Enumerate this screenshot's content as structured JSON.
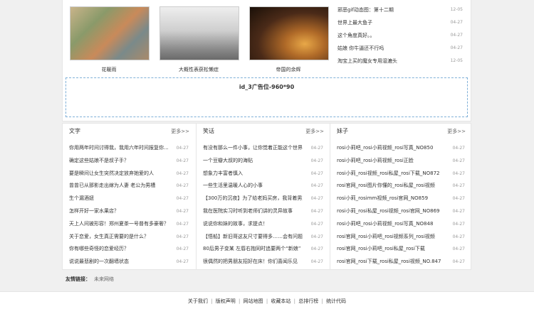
{
  "gallery": [
    {
      "caption": "花暖雨",
      "image": "rooftop-village-photo"
    },
    {
      "caption": "大概性表获松懒症",
      "image": "person-sitting-photo"
    },
    {
      "caption": "帝国的余辉",
      "image": "sunset-silhouette-photo"
    }
  ],
  "news": [
    {
      "title": "邪恶gif动态图：第十二期",
      "date": "12-05"
    },
    {
      "title": "世界上最大鱼子",
      "date": "04-27"
    },
    {
      "title": "这个角度真好。。",
      "date": "04-27"
    },
    {
      "title": "姑娘 你牛逼还不行吗",
      "date": "04-27"
    },
    {
      "title": "淘宝上买的魔女专用湿漉头",
      "date": "12-05"
    }
  ],
  "ad": {
    "label": "id_3广告位-960*90"
  },
  "columns": [
    {
      "title": "文字",
      "more": "更多>>",
      "items": [
        {
          "title": "你用两年时间讨得我，我用六年时间报复你...",
          "date": "04-27"
        },
        {
          "title": "确定这些姑娘不是叔子手？",
          "date": "04-27"
        },
        {
          "title": "要是瞬间让女生突然决定放弃她爱的人",
          "date": "04-27"
        },
        {
          "title": "曾曾已从那影走出嫁为人妻 老公为男槽",
          "date": "04-27"
        },
        {
          "title": "生个漏酒妞",
          "date": "04-27"
        },
        {
          "title": "怎样开好一家水果店？",
          "date": "04-27"
        },
        {
          "title": "天上人间被形容！郑州夏茶一号普有多豪奢？",
          "date": "04-27"
        },
        {
          "title": "关于恋爱，女生真正需要的是什么？",
          "date": "04-27"
        },
        {
          "title": "你有哪些奇怪的恋爱经历？",
          "date": "04-27"
        },
        {
          "title": "说说最悲剧的一次翻墙状态",
          "date": "04-27"
        }
      ]
    },
    {
      "title": "笑话",
      "more": "更多>>",
      "items": [
        {
          "title": "有没有那么一件小事，让你觉着正能这个世界",
          "date": "04-27"
        },
        {
          "title": "一个豆瓣大叔的的海贴",
          "date": "04-27"
        },
        {
          "title": "想象力丰富者慎入",
          "date": "04-27"
        },
        {
          "title": "一些生活里温暖人心的小事",
          "date": "04-27"
        },
        {
          "title": "【300万的沉夜】为了给老妈买房，我背着男友",
          "date": "04-27"
        },
        {
          "title": "我在医院实习时听到老师们讲的灵异故事",
          "date": "04-27"
        },
        {
          "title": "说说你和妹的故事，求提点！",
          "date": "04-27"
        },
        {
          "title": "【悟船】新旧哥这友尺寸要得多……会有问题",
          "date": "04-27"
        },
        {
          "title": "80后男子变某 左唇右抱同时追要两个“新娘”",
          "date": "04-27"
        },
        {
          "title": "很偶然的把男朋友招好在床！你们喜闻乐见",
          "date": "04-27"
        }
      ]
    },
    {
      "title": "妹子",
      "more": "更多>>",
      "items": [
        {
          "title": "rosi小莉吧_rosi小莉视频_rosi写真_NO850",
          "date": "04-27"
        },
        {
          "title": "rosi小莉吧_rosi小莉视频_rosi正脸",
          "date": "04-27"
        },
        {
          "title": "rosi小莉_rosi视频_rosi私屋_rosi下载_NO872",
          "date": "04-27"
        },
        {
          "title": "rosi官网_rosi图片你懂的_rosi私屋_rosi视频",
          "date": "04-27"
        },
        {
          "title": "rosi小莉_rosimm视频_rosi官网_NO859",
          "date": "04-27"
        },
        {
          "title": "rosi小莉_rosi私屋_rosi视频_rosi官网_NO869",
          "date": "04-27"
        },
        {
          "title": "rosi小莉吧_rosi小莉视频_rosi写真_NO848",
          "date": "04-27"
        },
        {
          "title": "rosi官网_rosi小莉吧_rosi视频系列_rosi视频",
          "date": "04-27"
        },
        {
          "title": "rosi官网_rosi小莉吧_rosi私屋_rosi下载",
          "date": "04-27"
        },
        {
          "title": "rosi官网_rosi下载_rosi私屋_rosi视频_NO.847",
          "date": "04-27"
        }
      ]
    }
  ],
  "friends": {
    "label": "友情链接：",
    "link": "未来网络"
  },
  "footer": {
    "links": [
      "关于我们",
      "版权声明",
      "网站地图",
      "收藏本站",
      "总排行榜",
      "统计代码"
    ],
    "separator": "|"
  }
}
